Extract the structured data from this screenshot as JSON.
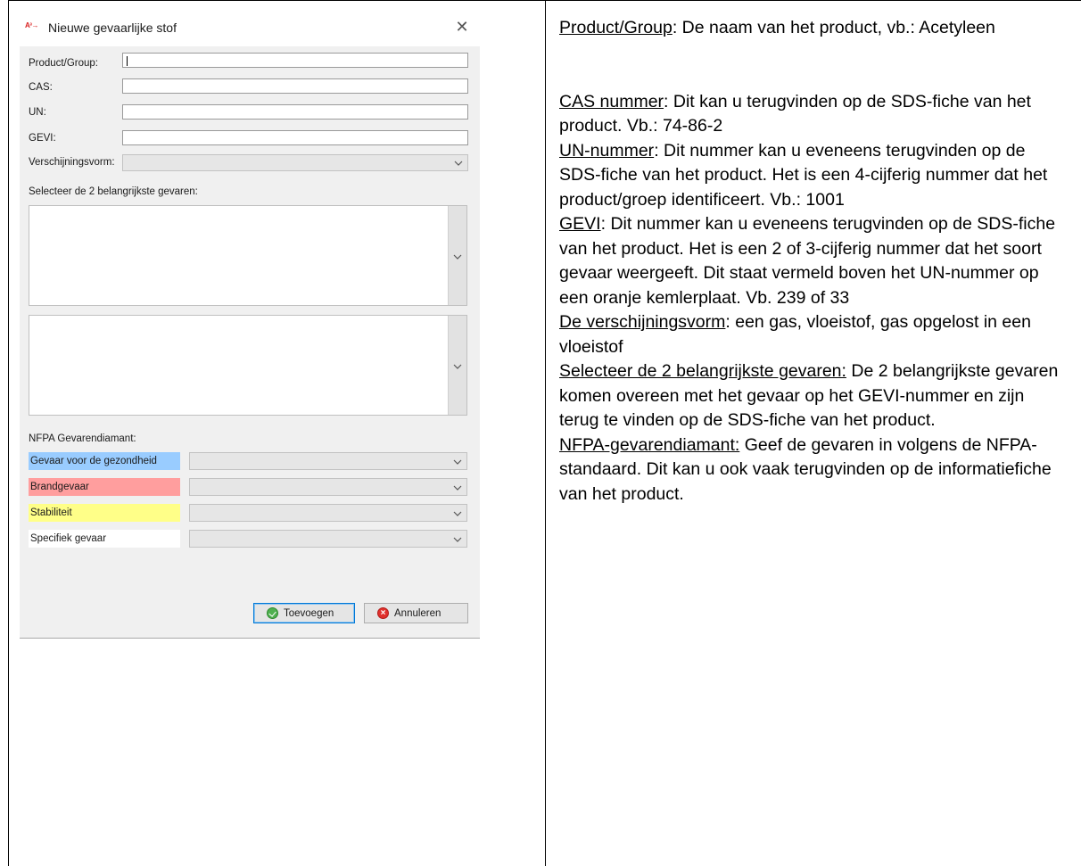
{
  "dialog": {
    "app_icon": "A³→",
    "title": "Nieuwe gevaarlijke stof",
    "close_glyph": "✕",
    "fields": {
      "product_label": "Product/Group:",
      "cas_label": "CAS:",
      "un_label": "UN:",
      "gevi_label": "GEVI:",
      "verschijningsvorm_label": "Verschijningsvorm:"
    },
    "hazards_label": "Selecteer de 2 belangrijkste gevaren:",
    "nfpa": {
      "title": "NFPA Gevarendiamant:",
      "rows": [
        {
          "label": "Gevaar voor de gezondheid",
          "color": "#99ccff"
        },
        {
          "label": "Brandgevaar",
          "color": "#ff9e9e"
        },
        {
          "label": "Stabiliteit",
          "color": "#ffff88"
        },
        {
          "label": "Specifiek gevaar",
          "color": "#ffffff"
        }
      ]
    },
    "buttons": {
      "add": "Toevoegen",
      "cancel": "Annuleren"
    }
  },
  "description": {
    "product": {
      "term": "Product/Group",
      "text": ": De naam van het product, vb.: Acetyleen"
    },
    "cas": {
      "term": "CAS nummer",
      "text": ": Dit kan u terugvinden op de SDS-fiche van het product. Vb.: 74-86-2"
    },
    "un": {
      "term": "UN-nummer",
      "text": ": Dit nummer kan u eveneens terugvinden op de SDS-fiche van het product. Het is een 4-cijferig nummer dat het product/groep identificeert. Vb.: 1001"
    },
    "gevi": {
      "term": "GEVI",
      "text": ": Dit nummer kan u eveneens terugvinden op de SDS-fiche van het product. Het is een 2 of 3-cijferig nummer dat het soort gevaar weergeeft. Dit staat vermeld boven het UN-nummer op een oranje kemlerplaat. Vb. 239 of 33"
    },
    "verschijningsvorm": {
      "term": "De verschijningsvorm",
      "text": ": een gas, vloeistof, gas opgelost in een vloeistof"
    },
    "gevaren": {
      "term": "Selecteer de 2 belangrijkste gevaren:",
      "text": " De 2 belangrijkste gevaren komen overeen met het gevaar op het GEVI-nummer en zijn terug te vinden op de SDS-fiche van het product."
    },
    "nfpa": {
      "term": "NFPA-gevarendiamant:",
      "text": " Geef de gevaren in volgens de NFPA-standaard. Dit kan u ook vaak terugvinden op de informatiefiche van het product."
    }
  }
}
